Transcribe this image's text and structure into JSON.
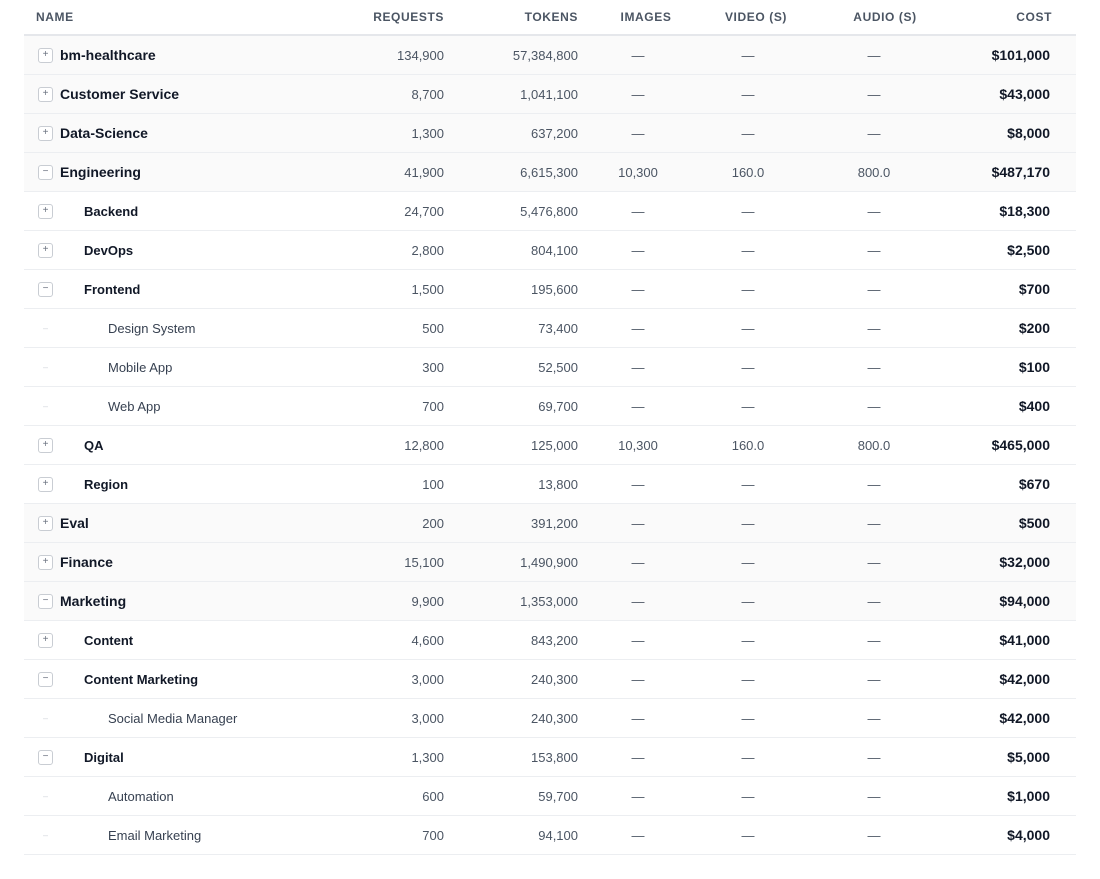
{
  "columns": {
    "name": "NAME",
    "requests": "REQUESTS",
    "tokens": "TOKENS",
    "images": "IMAGES",
    "video": "VIDEO (S)",
    "audio": "AUDIO (S)",
    "cost": "COST"
  },
  "rows": [
    {
      "level": 0,
      "toggle": "+",
      "name": "bm-healthcare",
      "requests": "134,900",
      "tokens": "57,384,800",
      "images": "—",
      "video": "—",
      "audio": "—",
      "cost": "$101,000"
    },
    {
      "level": 0,
      "toggle": "+",
      "name": "Customer Service",
      "requests": "8,700",
      "tokens": "1,041,100",
      "images": "—",
      "video": "—",
      "audio": "—",
      "cost": "$43,000"
    },
    {
      "level": 0,
      "toggle": "+",
      "name": "Data-Science",
      "requests": "1,300",
      "tokens": "637,200",
      "images": "—",
      "video": "—",
      "audio": "—",
      "cost": "$8,000"
    },
    {
      "level": 0,
      "toggle": "−",
      "name": "Engineering",
      "requests": "41,900",
      "tokens": "6,615,300",
      "images": "10,300",
      "video": "160.0",
      "audio": "800.0",
      "cost": "$487,170"
    },
    {
      "level": 1,
      "toggle": "+",
      "name": "Backend",
      "requests": "24,700",
      "tokens": "5,476,800",
      "images": "—",
      "video": "—",
      "audio": "—",
      "cost": "$18,300"
    },
    {
      "level": 1,
      "toggle": "+",
      "name": "DevOps",
      "requests": "2,800",
      "tokens": "804,100",
      "images": "—",
      "video": "—",
      "audio": "—",
      "cost": "$2,500"
    },
    {
      "level": 1,
      "toggle": "−",
      "name": "Frontend",
      "requests": "1,500",
      "tokens": "195,600",
      "images": "—",
      "video": "—",
      "audio": "—",
      "cost": "$700"
    },
    {
      "level": 2,
      "toggle": "",
      "name": "Design System",
      "requests": "500",
      "tokens": "73,400",
      "images": "—",
      "video": "—",
      "audio": "—",
      "cost": "$200"
    },
    {
      "level": 2,
      "toggle": "",
      "name": "Mobile App",
      "requests": "300",
      "tokens": "52,500",
      "images": "—",
      "video": "—",
      "audio": "—",
      "cost": "$100"
    },
    {
      "level": 2,
      "toggle": "",
      "name": "Web App",
      "requests": "700",
      "tokens": "69,700",
      "images": "—",
      "video": "—",
      "audio": "—",
      "cost": "$400"
    },
    {
      "level": 1,
      "toggle": "+",
      "name": "QA",
      "requests": "12,800",
      "tokens": "125,000",
      "images": "10,300",
      "video": "160.0",
      "audio": "800.0",
      "cost": "$465,000"
    },
    {
      "level": 1,
      "toggle": "+",
      "name": "Region",
      "requests": "100",
      "tokens": "13,800",
      "images": "—",
      "video": "—",
      "audio": "—",
      "cost": "$670"
    },
    {
      "level": 0,
      "toggle": "+",
      "name": "Eval",
      "requests": "200",
      "tokens": "391,200",
      "images": "—",
      "video": "—",
      "audio": "—",
      "cost": "$500"
    },
    {
      "level": 0,
      "toggle": "+",
      "name": "Finance",
      "requests": "15,100",
      "tokens": "1,490,900",
      "images": "—",
      "video": "—",
      "audio": "—",
      "cost": "$32,000"
    },
    {
      "level": 0,
      "toggle": "−",
      "name": "Marketing",
      "requests": "9,900",
      "tokens": "1,353,000",
      "images": "—",
      "video": "—",
      "audio": "—",
      "cost": "$94,000"
    },
    {
      "level": 1,
      "toggle": "+",
      "name": "Content",
      "requests": "4,600",
      "tokens": "843,200",
      "images": "—",
      "video": "—",
      "audio": "—",
      "cost": "$41,000"
    },
    {
      "level": 1,
      "toggle": "−",
      "name": "Content Marketing",
      "requests": "3,000",
      "tokens": "240,300",
      "images": "—",
      "video": "—",
      "audio": "—",
      "cost": "$42,000"
    },
    {
      "level": 2,
      "toggle": "",
      "name": "Social Media Manager",
      "requests": "3,000",
      "tokens": "240,300",
      "images": "—",
      "video": "—",
      "audio": "—",
      "cost": "$42,000"
    },
    {
      "level": 1,
      "toggle": "−",
      "name": "Digital",
      "requests": "1,300",
      "tokens": "153,800",
      "images": "—",
      "video": "—",
      "audio": "—",
      "cost": "$5,000"
    },
    {
      "level": 2,
      "toggle": "",
      "name": "Automation",
      "requests": "600",
      "tokens": "59,700",
      "images": "—",
      "video": "—",
      "audio": "—",
      "cost": "$1,000"
    },
    {
      "level": 2,
      "toggle": "",
      "name": "Email Marketing",
      "requests": "700",
      "tokens": "94,100",
      "images": "—",
      "video": "—",
      "audio": "—",
      "cost": "$4,000"
    }
  ]
}
